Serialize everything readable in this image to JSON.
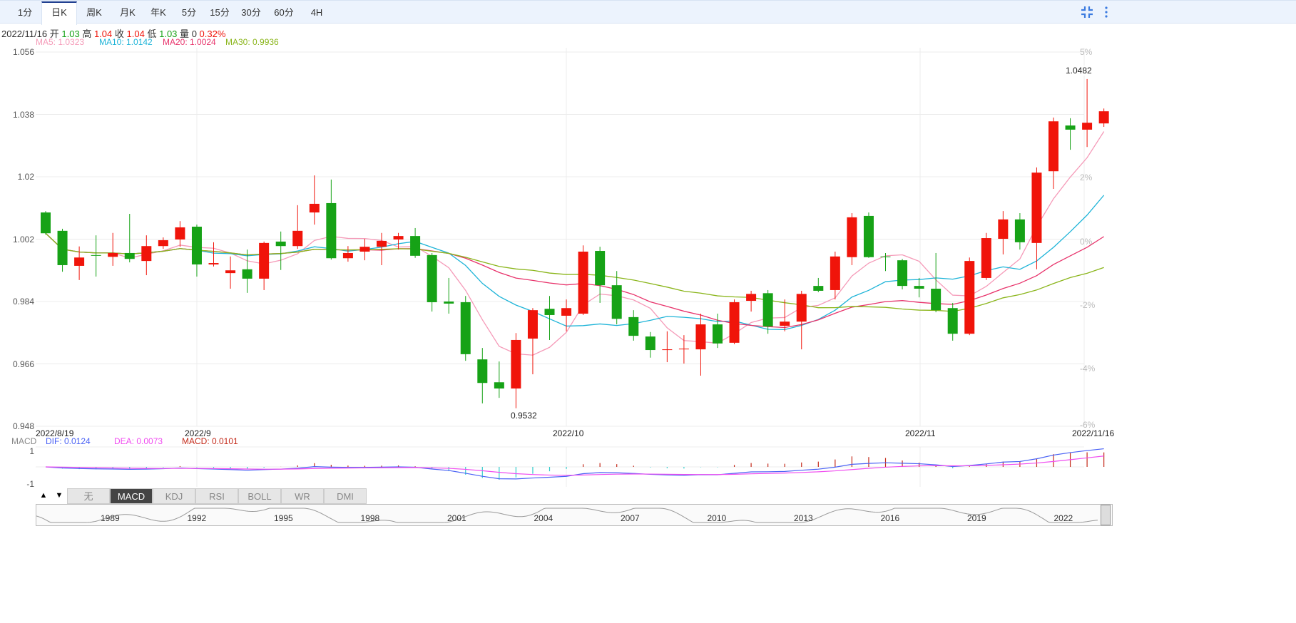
{
  "toolbar": {
    "tabs": [
      "1分",
      "日K",
      "周K",
      "月K",
      "年K",
      "5分",
      "15分",
      "30分",
      "60分",
      "4H"
    ],
    "active": 1,
    "icons": [
      "compress-icon",
      "more-vertical-icon"
    ]
  },
  "info": {
    "date": "2022/11/16",
    "open_label": "开",
    "open": "1.03",
    "high_label": "高",
    "high": "1.04",
    "close_label": "收",
    "close": "1.04",
    "low_label": "低",
    "low": "1.03",
    "volume_label": "量",
    "volume": "0",
    "change": "0.32%"
  },
  "ma_legend": [
    {
      "label": "MA5: 1.0323",
      "color": "#f59ab8"
    },
    {
      "label": "MA10: 1.0142",
      "color": "#1eb4d8"
    },
    {
      "label": "MA20: 1.0024",
      "color": "#e8336b"
    },
    {
      "label": "MA30: 0.9936",
      "color": "#8ab51a"
    }
  ],
  "colors": {
    "up": "#f0140a",
    "down": "#16a216",
    "dif": "#4a62f5",
    "dea": "#f04df0",
    "macd_bar": "#c42a1a"
  },
  "macd_legend": {
    "title": "MACD",
    "dif": "DIF: 0.0124",
    "dea": "DEA: 0.0073",
    "macd": "MACD: 0.0101"
  },
  "indicator_tabs": [
    "无",
    "MACD",
    "KDJ",
    "RSI",
    "BOLL",
    "WR",
    "DMI"
  ],
  "indicator_active": 1,
  "navigator_years": [
    "1989",
    "1992",
    "1995",
    "1998",
    "2001",
    "2004",
    "2007",
    "2010",
    "2013",
    "2016",
    "2019",
    "2022"
  ],
  "chart_data": {
    "type": "candlestick",
    "y_ticks": [
      "1.056",
      "1.038",
      "1.02",
      "1.002",
      "0.984",
      "0.966",
      "0.948"
    ],
    "ylim": [
      0.948,
      1.056
    ],
    "pct_ticks": [
      "5%",
      "2%",
      "0%",
      "-2%",
      "-4%",
      "-6%"
    ],
    "x_labels": [
      "2022/8/19",
      "2022/9",
      "2022/10",
      "2022/11",
      "2022/11/16"
    ],
    "macd_ticks": [
      "1",
      "-1"
    ],
    "annotations": {
      "max": "1.0482",
      "min": "0.9532"
    },
    "ohlc": [
      [
        1.0097,
        1.0037,
        1.0101,
        1.0033
      ],
      [
        1.0044,
        0.9945,
        1.005,
        0.9926
      ],
      [
        0.9943,
        0.9967,
        0.9999,
        0.9902
      ],
      [
        0.9974,
        0.9972,
        1.0031,
        0.9912
      ],
      [
        0.9969,
        0.998,
        1.0038,
        0.9943
      ],
      [
        0.998,
        0.9963,
        1.0093,
        0.9953
      ],
      [
        0.9957,
        1.0,
        1.0031,
        0.9916
      ],
      [
        1.0,
        1.0017,
        1.0025,
        0.9992
      ],
      [
        1.0019,
        1.0054,
        1.0072,
        0.9998
      ],
      [
        1.0056,
        0.9947,
        1.0062,
        0.9912
      ],
      [
        0.9947,
        0.9951,
        1.0011,
        0.9941
      ],
      [
        0.9922,
        0.993,
        0.997,
        0.9877
      ],
      [
        0.9933,
        0.9906,
        0.999,
        0.9865
      ],
      [
        0.9906,
        1.0009,
        1.0013,
        0.9873
      ],
      [
        1.0013,
        1.0,
        1.0042,
        0.9931
      ],
      [
        1.0,
        1.0044,
        1.0118,
        0.9992
      ],
      [
        1.0097,
        1.0122,
        1.0204,
        1.0062
      ],
      [
        1.0124,
        0.9965,
        1.0192,
        0.9961
      ],
      [
        0.9965,
        0.998,
        1.0,
        0.9955
      ],
      [
        0.9984,
        0.9998,
        1.0021,
        0.9959
      ],
      [
        0.9998,
        1.0015,
        1.0038,
        0.9945
      ],
      [
        1.0019,
        1.0029,
        1.0038,
        0.999
      ],
      [
        1.0029,
        0.9972,
        1.0052,
        0.9966
      ],
      [
        0.9974,
        0.9838,
        0.998,
        0.9811
      ],
      [
        0.984,
        0.9834,
        0.9908,
        0.9805
      ],
      [
        0.9838,
        0.9688,
        0.9856,
        0.9669
      ],
      [
        0.9673,
        0.9605,
        0.9706,
        0.9546
      ],
      [
        0.9607,
        0.9589,
        0.9667,
        0.9562
      ],
      [
        0.9589,
        0.9729,
        0.9749,
        0.9532
      ],
      [
        0.9733,
        0.9815,
        0.9821,
        0.963
      ],
      [
        0.9819,
        0.9801,
        0.9856,
        0.9729
      ],
      [
        0.9799,
        0.9821,
        0.9846,
        0.9754
      ],
      [
        0.9805,
        0.9984,
        1.0002,
        0.9801
      ],
      [
        0.9986,
        0.9887,
        0.9998,
        0.9836
      ],
      [
        0.9887,
        0.979,
        0.9928,
        0.9774
      ],
      [
        0.9795,
        0.9741,
        0.9815,
        0.9727
      ],
      [
        0.9739,
        0.97,
        0.9752,
        0.9678
      ],
      [
        0.97,
        0.9702,
        0.9754,
        0.9665
      ],
      [
        0.9702,
        0.9704,
        0.9743,
        0.9661
      ],
      [
        0.9702,
        0.9774,
        0.9805,
        0.9626
      ],
      [
        0.9774,
        0.9719,
        0.9805,
        0.9706
      ],
      [
        0.9721,
        0.9838,
        0.9846,
        0.9717
      ],
      [
        0.9842,
        0.9862,
        0.9871,
        0.9811
      ],
      [
        0.9864,
        0.9768,
        0.9873,
        0.9747
      ],
      [
        0.977,
        0.9782,
        0.9846,
        0.9754
      ],
      [
        0.9782,
        0.9862,
        0.9871,
        0.9702
      ],
      [
        0.9885,
        0.9871,
        0.9908,
        0.9867
      ],
      [
        0.9873,
        0.997,
        0.9984,
        0.9846
      ],
      [
        0.9968,
        1.0083,
        1.0095,
        0.9945
      ],
      [
        1.0087,
        0.9968,
        1.0097,
        0.9966
      ],
      [
        0.997,
        0.9968,
        0.998,
        0.9928
      ],
      [
        0.9959,
        0.9885,
        0.9963,
        0.9875
      ],
      [
        0.9885,
        0.9877,
        0.9908,
        0.9852
      ],
      [
        0.9877,
        0.9815,
        0.998,
        0.9809
      ],
      [
        0.9821,
        0.9747,
        0.9836,
        0.9727
      ],
      [
        0.9747,
        0.9957,
        0.9967,
        0.9743
      ],
      [
        0.9908,
        1.0023,
        1.0038,
        0.9902
      ],
      [
        1.0021,
        1.0077,
        1.0101,
        0.9976
      ],
      [
        1.0077,
        1.0011,
        1.0095,
        0.999
      ],
      [
        1.0009,
        1.0212,
        1.0227,
        0.9933
      ],
      [
        1.0216,
        1.036,
        1.0371,
        1.0165
      ],
      [
        1.0348,
        1.0336,
        1.0369,
        1.0278
      ],
      [
        1.0336,
        1.0356,
        1.0482,
        1.0286
      ],
      [
        1.0354,
        1.0389,
        1.0397,
        1.0344
      ]
    ]
  }
}
